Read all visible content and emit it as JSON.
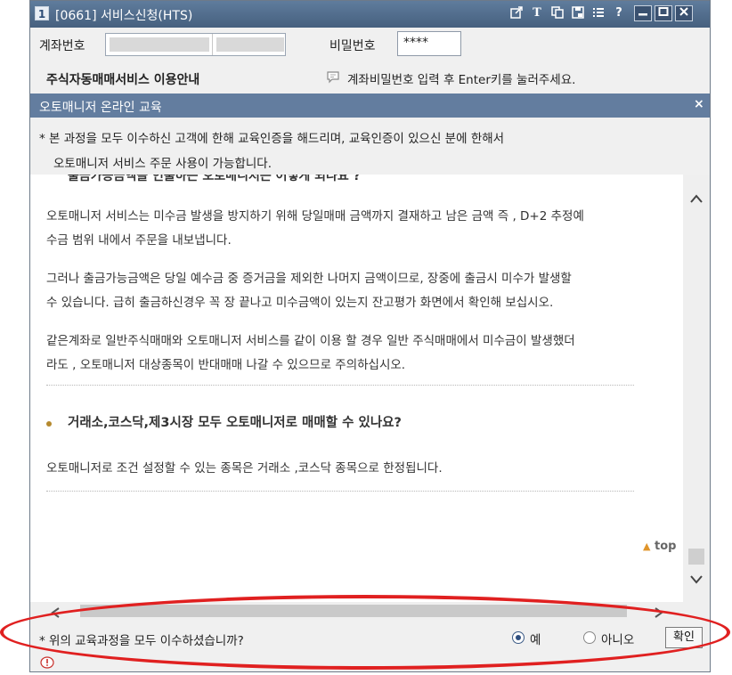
{
  "window": {
    "number": "1",
    "title": "[0661] 서비스신청(HTS)"
  },
  "form": {
    "account_label": "계좌번호",
    "password_label": "비밀번호",
    "password_value": "****",
    "service_title": "주식자동매매서비스 이용안내",
    "hint": "계좌비밀번호 입력 후 Enter키를 눌러주세요."
  },
  "notice": {
    "title": "오토매니저 온라인 교육",
    "close": "×",
    "line1": "* 본 과정을 모두 이수하신 고객에 한해 교육인증을 해드리며, 교육인증이 있으신 분에 한해서",
    "line2": "오토매니저 서비스 주문 사용이 가능합니다."
  },
  "content": {
    "cut_heading": "출금가능금액을 인출하는 오토매니저는 어떻게 되나요 ?",
    "p1_l1": "오토매니저 서비스는 미수금 발생을 방지하기 위해 당일매매 금액까지 결재하고 남은 금액 즉 , D+2 추정예",
    "p1_l2": "수금 범위 내에서 주문을 내보냅니다.",
    "p2_l1": "그러나 출금가능금액은 당일 예수금 중 증거금을 제외한 나머지 금액이므로, 장중에 출금시 미수가 발생할",
    "p2_l2": "수 있습니다. 급히 출금하신경우 꼭 장 끝나고 미수금액이 있는지 잔고평가 화면에서 확인해 보십시오.",
    "p3_l1": "같은계좌로 일반주식매매와 오토매니저 서비스를 같이 이용 할 경우 일반 주식매매에서 미수금이 발생했더",
    "p3_l2": "라도 , 오토매니저 대상종목이 반대매매 나갈 수 있으므로 주의하십시오.",
    "question": "거래소,코스닥,제3시장 모두 오토매니저로 매매할 수 있나요?",
    "answer": "오토매니저로 조건 설정할 수 있는 종목은 거래소 ,코스닥 종목으로 한정됩니다.",
    "top_link": "top"
  },
  "bottom": {
    "question": "* 위의 교육과정을 모두 이수하셨습니까?",
    "yes": "예",
    "no": "아니오",
    "confirm": "확인"
  },
  "colors": {
    "titlebar": "#4f6a8c",
    "notice_bar": "#637d9f",
    "highlight": "#e02020"
  }
}
